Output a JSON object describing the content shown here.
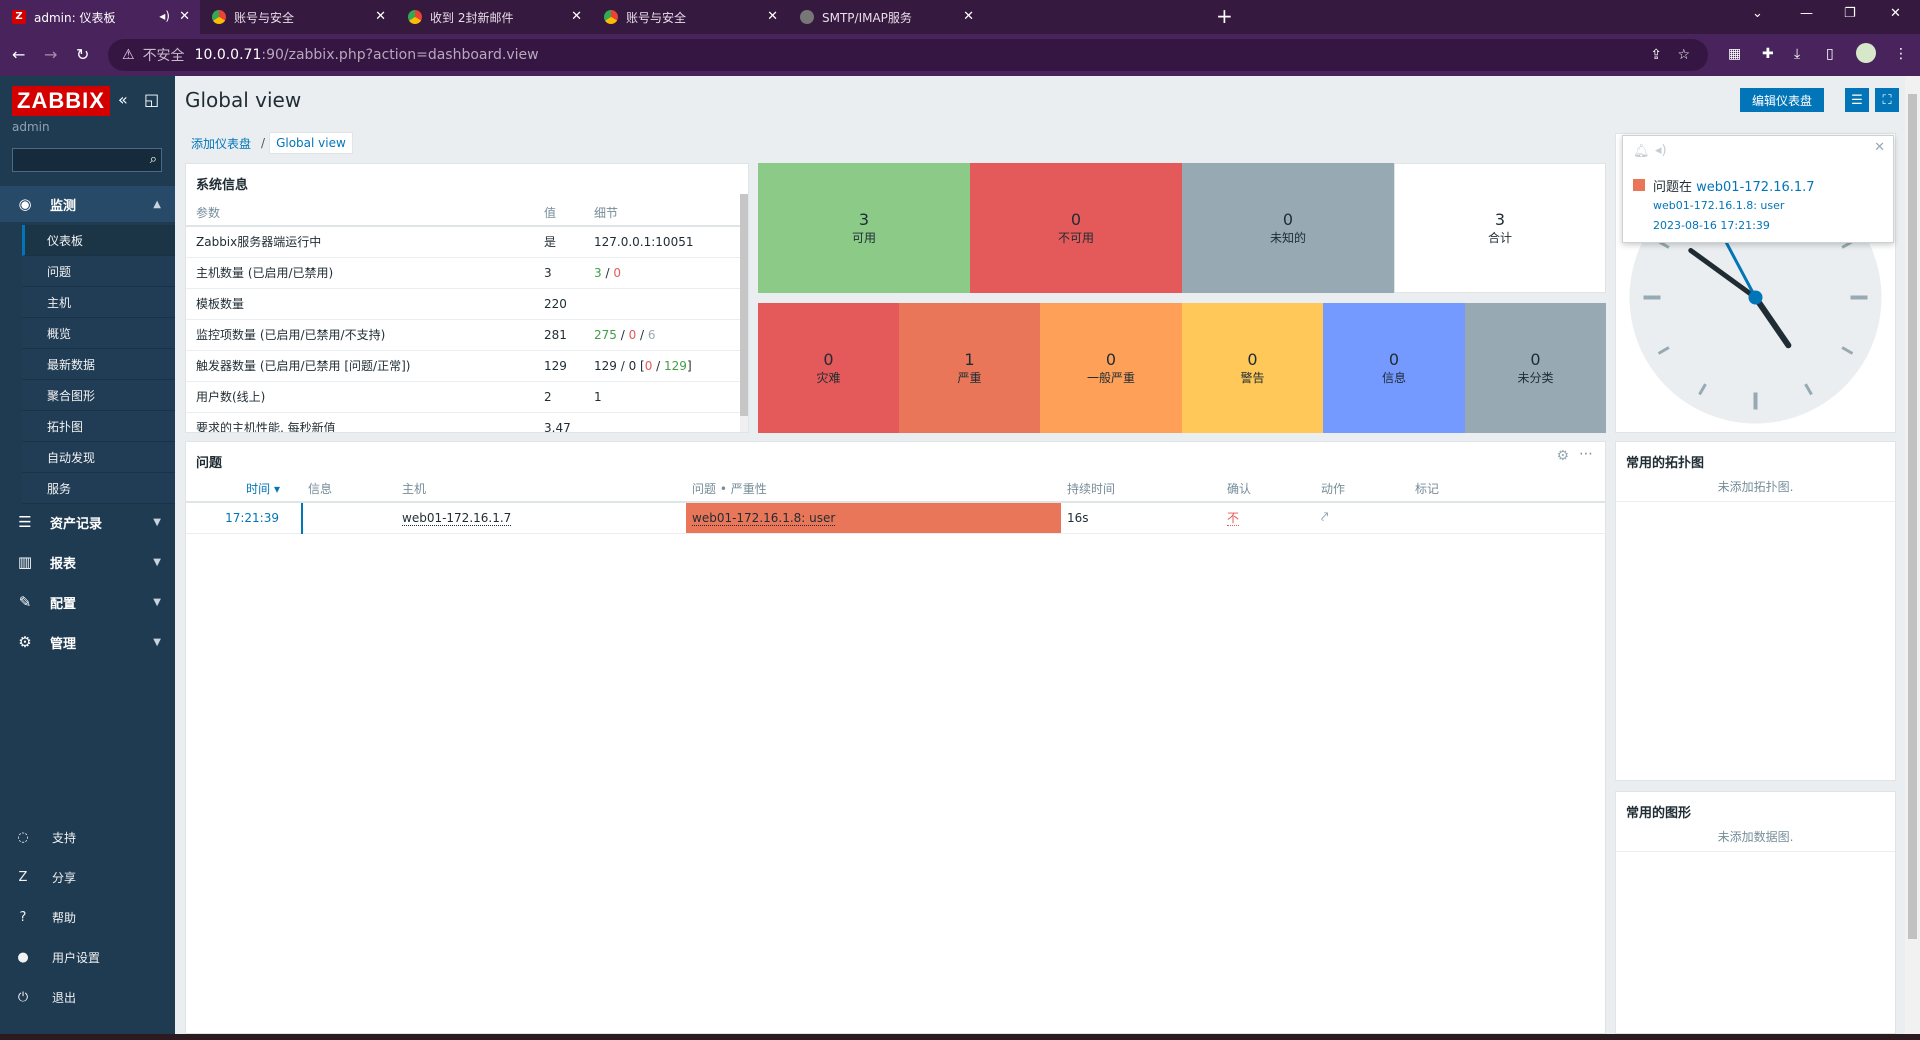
{
  "browser": {
    "tabs": [
      {
        "title": "admin: 仪表板",
        "active": true
      },
      {
        "title": "账号与安全",
        "active": false
      },
      {
        "title": "收到 2封新邮件",
        "active": false
      },
      {
        "title": "账号与安全",
        "active": false
      },
      {
        "title": "SMTP/IMAP服务",
        "active": false
      }
    ],
    "url_warning": "不安全",
    "url_host": "10.0.0.71",
    "url_path": ":90/zabbix.php?action=dashboard.view"
  },
  "sidebar": {
    "logo": "ZABBIX",
    "user": "admin",
    "search_value": "",
    "monitoring": {
      "label": "监测",
      "icon": "eye-icon"
    },
    "monitoring_items": [
      "仪表板",
      "问题",
      "主机",
      "概览",
      "最新数据",
      "聚合图形",
      "拓扑图",
      "自动发现",
      "服务"
    ],
    "inventory": {
      "label": "资产记录",
      "icon": "list-icon"
    },
    "reports": {
      "label": "报表",
      "icon": "bar-chart-icon"
    },
    "config": {
      "label": "配置",
      "icon": "wrench-icon"
    },
    "admin": {
      "label": "管理",
      "icon": "gear-icon"
    },
    "bottom": [
      {
        "label": "支持",
        "icon": "headset-icon"
      },
      {
        "label": "分享",
        "icon": "share-icon"
      },
      {
        "label": "帮助",
        "icon": "question-icon"
      },
      {
        "label": "用户设置",
        "icon": "user-icon"
      },
      {
        "label": "退出",
        "icon": "power-icon"
      }
    ]
  },
  "header": {
    "title": "Global view",
    "edit_label": "编辑仪表盘"
  },
  "breadcrumb": {
    "parent": "添加仪表盘",
    "current": "Global view"
  },
  "sysinfo": {
    "title": "系统信息",
    "col_param": "参数",
    "col_value": "值",
    "col_detail": "细节",
    "rows": [
      {
        "param": "Zabbix服务器端运行中",
        "value": "是",
        "detail": "127.0.0.1:10051"
      },
      {
        "param": "主机数量 (已启用/已禁用)",
        "value": "3",
        "d1": "3",
        "dsep": " / ",
        "d2": "0"
      },
      {
        "param": "模板数量",
        "value": "220",
        "detail": ""
      },
      {
        "param": "监控项数量 (已启用/已禁用/不支持)",
        "value": "281",
        "d1": "275",
        "dsep1": " / ",
        "d2": "0",
        "dsep2": " / ",
        "d3": "6"
      },
      {
        "param": "触发器数量 (已启用/已禁用 [问题/正常])",
        "value": "129",
        "d0": "129 / 0 [",
        "d2": "0",
        "dsep": " / ",
        "d3": "129",
        "dend": "]"
      },
      {
        "param": "用户数(线上)",
        "value": "2",
        "d1": "1"
      },
      {
        "param": "要求的主机性能, 每秒新值",
        "value": "3.47",
        "detail": ""
      }
    ]
  },
  "host_availability": {
    "tiles": [
      {
        "count": "3",
        "label": "可用",
        "color": "#8ccb87"
      },
      {
        "count": "0",
        "label": "不可用",
        "color": "#e45959"
      },
      {
        "count": "0",
        "label": "未知的",
        "color": "#97aab3"
      },
      {
        "count": "3",
        "label": "合计",
        "color": "#ffffff"
      }
    ]
  },
  "severity": {
    "tiles": [
      {
        "count": "0",
        "label": "灾难",
        "color": "#e45959"
      },
      {
        "count": "1",
        "label": "严重",
        "color": "#e97659"
      },
      {
        "count": "0",
        "label": "一般严重",
        "color": "#ffa059"
      },
      {
        "count": "0",
        "label": "警告",
        "color": "#ffc859"
      },
      {
        "count": "0",
        "label": "信息",
        "color": "#7499ff"
      },
      {
        "count": "0",
        "label": "未分类",
        "color": "#97aab3"
      }
    ]
  },
  "problems": {
    "title": "问题",
    "columns": [
      "时间 ▾",
      "信息",
      "主机",
      "问题 • 严重性",
      "持续时间",
      "确认",
      "动作",
      "标记"
    ],
    "rows": [
      {
        "time": "17:21:39",
        "info": "",
        "host": "web01-172.16.1.7",
        "problem": "web01-172.16.1.8: user",
        "duration": "16s",
        "ack": "不",
        "tags": ""
      }
    ]
  },
  "notification": {
    "prefix": "问题在 ",
    "host": "web01-172.16.1.7",
    "detail": "web01-172.16.1.8: user",
    "time": "2023-08-16 17:21:39"
  },
  "maps_widget": {
    "title": "常用的拓扑图",
    "empty": "未添加拓扑图."
  },
  "graphs_widget": {
    "title": "常用的图形",
    "empty": "未添加数据图."
  },
  "clock": {
    "hour": 4,
    "minute": 51
  }
}
